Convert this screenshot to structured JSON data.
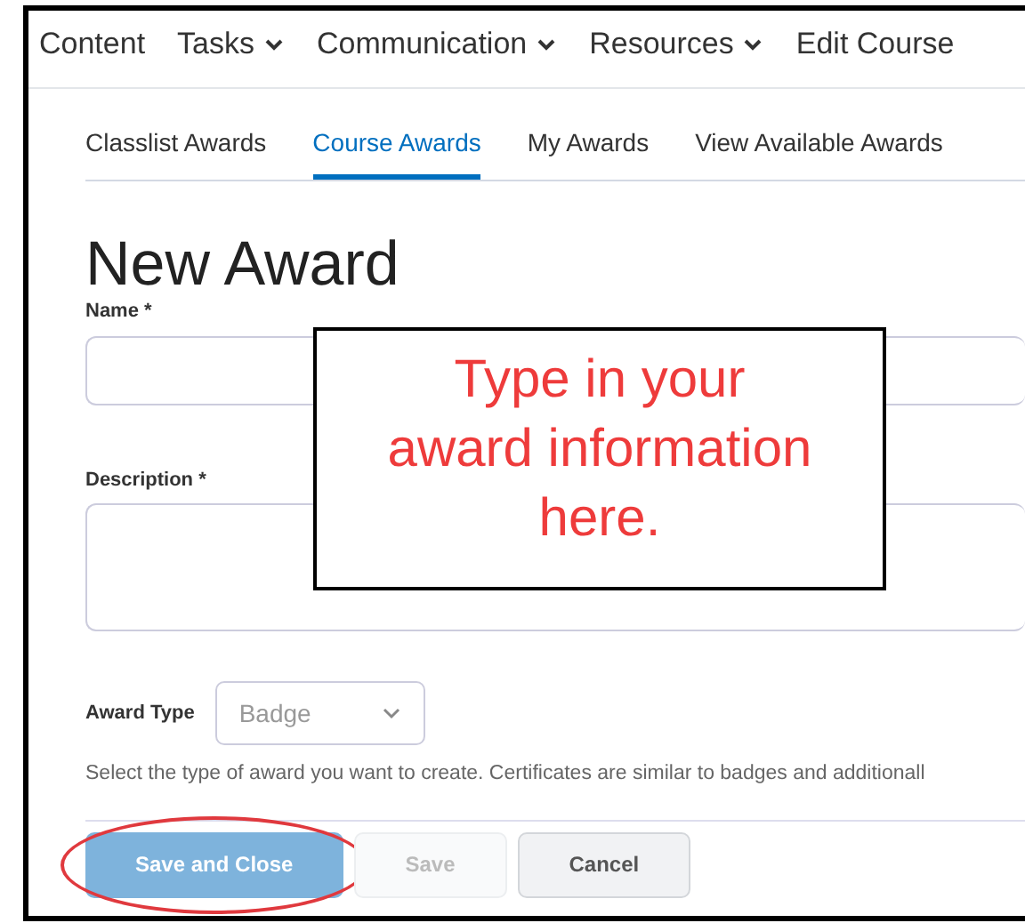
{
  "nav": [
    {
      "label": "Content",
      "dropdown": false
    },
    {
      "label": "Tasks",
      "dropdown": true
    },
    {
      "label": "Communication",
      "dropdown": true
    },
    {
      "label": "Resources",
      "dropdown": true
    },
    {
      "label": "Edit Course",
      "dropdown": false
    }
  ],
  "tabs": [
    {
      "label": "Classlist Awards",
      "selected": false
    },
    {
      "label": "Course Awards",
      "selected": true
    },
    {
      "label": "My Awards",
      "selected": false
    },
    {
      "label": "View Available Awards",
      "selected": false
    }
  ],
  "heading": "New Award",
  "name_field": {
    "label": "Name *"
  },
  "description_field": {
    "label": "Description *"
  },
  "award_type": {
    "label": "Award Type",
    "value": "Badge",
    "help": "Select the type of award you want to create. Certificates are similar to badges and additionall"
  },
  "buttons": [
    {
      "label": "Save and Close",
      "kind": "primary",
      "disabled": false,
      "circled": true
    },
    {
      "label": "Save",
      "kind": "secondary",
      "disabled": true,
      "circled": false
    },
    {
      "label": "Cancel",
      "kind": "secondary",
      "disabled": false,
      "circled": false
    }
  ],
  "callout": "Type in your award information here."
}
